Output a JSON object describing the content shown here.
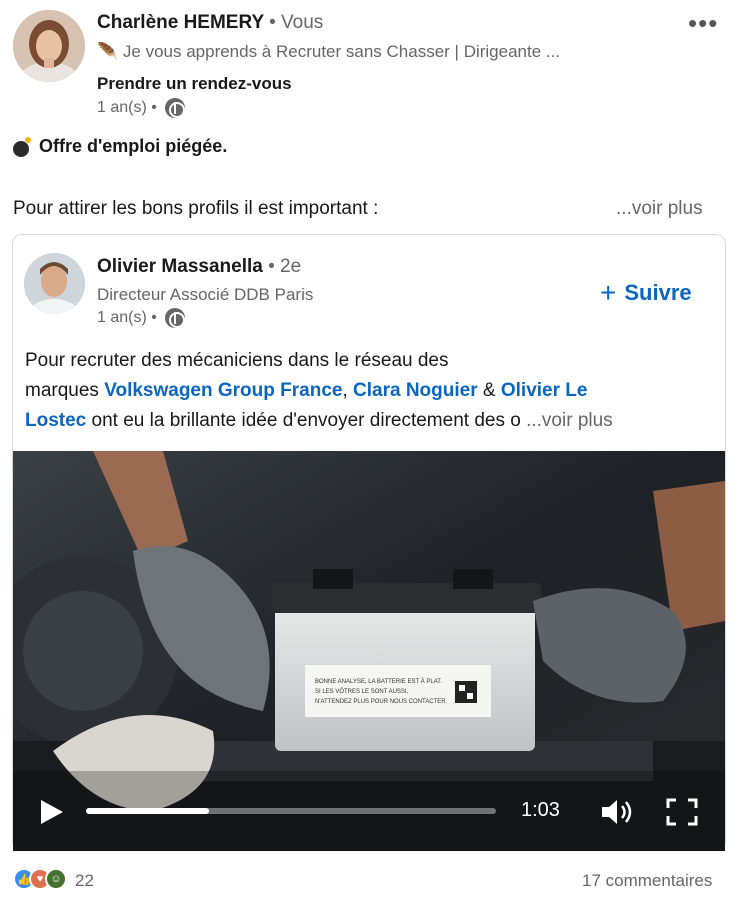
{
  "post": {
    "author": {
      "name": "Charlène HEMERY",
      "relation": "• Vous",
      "headline": "🪶 Je vous apprends à Recruter sans Chasser | Dirigeante ...",
      "cta_link": "Prendre un rendez-vous",
      "time": "1 an(s) •"
    },
    "title": "Offre d'emploi piégée.",
    "body": "Pour attirer les bons profils il est important :",
    "see_more": "...voir plus",
    "reactions_count": "22",
    "comments_count": "17 commentaires"
  },
  "shared": {
    "author": {
      "name": "Olivier Massanella",
      "degree": "• 2e",
      "headline": "Directeur Associé DDB Paris",
      "time": "1 an(s) •"
    },
    "follow_label": "Suivre",
    "text": {
      "line1": "Pour recruter des mécaniciens dans le réseau des",
      "line2_prefix": "marques ",
      "mention1": "Volkswagen Group France",
      "sep1": ", ",
      "mention2": "Clara Noguier",
      "sep2": " & ",
      "mention3_part1": "Olivier Le",
      "mention3_part2": "Lostec",
      "line3_rest": " ont eu la brillante idée d'envoyer directement des o",
      "see_more": "...voir plus"
    },
    "video": {
      "label_lines": [
        "BONNE ANALYSE, LA BATTERIE EST À PLAT.",
        "SI LES VÔTRES LE SONT AUSSI,",
        "N'ATTENDEZ PLUS POUR NOUS CONTACTER."
      ],
      "duration": "1:03",
      "progress": 0.3
    }
  }
}
